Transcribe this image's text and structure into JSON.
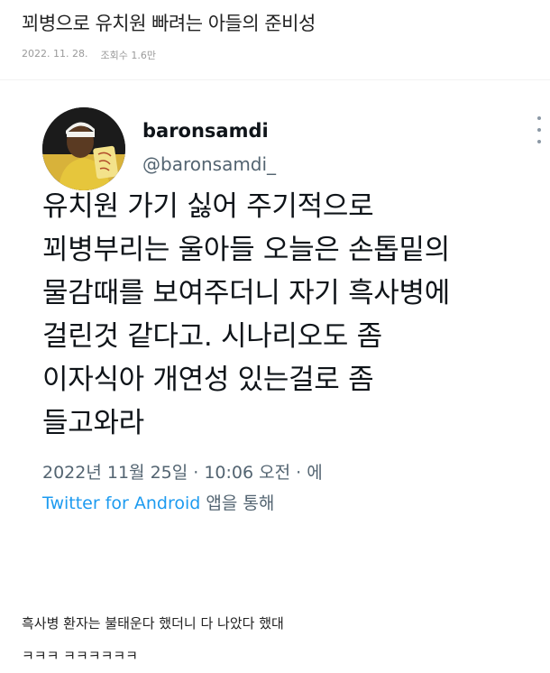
{
  "post": {
    "title": "꾀병으로 유치원 빠려는 아들의 준비성",
    "date": "2022. 11. 28.",
    "views": "조회수 1.6만"
  },
  "tweet": {
    "author_name": "baronsamdi",
    "author_handle": "@baronsamdi_",
    "text": "유치원 가기 싫어 주기적으로\n꾀병부리는 울아들 오늘은 손톱밑의\n물감때를 보여주더니 자기 흑사병에\n걸린것 같다고. 시나리오도 좀\n이자식아 개연성 있는걸로 좀\n들고와라",
    "timestamp": "2022년 11월 25일 · 10:06 오전 · 에",
    "source_link": "Twitter for Android",
    "source_suffix": " 앱을 통해"
  },
  "comment": {
    "line1": "흑사병 환자는 불태운다 했더니 다 나았다 했대",
    "line2": "ㅋㅋㅋ ㅋㅋㅋㅋㅋㅋ"
  },
  "colors": {
    "twitter_blue": "#1d9bf0",
    "muted_gray": "#536471"
  },
  "icons": {
    "more": "more-vertical-icon",
    "avatar": "profile-avatar"
  }
}
